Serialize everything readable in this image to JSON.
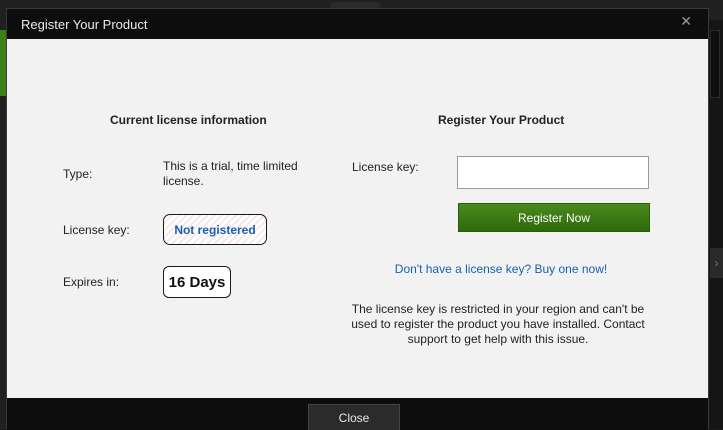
{
  "dialog": {
    "title": "Register Your Product",
    "close_icon": "close-icon"
  },
  "license_info": {
    "heading": "Current license information",
    "type_label": "Type:",
    "type_value": "This is a trial, time limited license.",
    "key_label": "License key:",
    "key_value": "Not registered",
    "expires_label": "Expires in:",
    "expires_value": "16 Days"
  },
  "register": {
    "heading": "Register Your Product",
    "key_label": "License key:",
    "key_input_value": "",
    "button_label": "Register Now",
    "buy_link": "Don't have a license key? Buy one now!",
    "notice": "The license key is restricted in your region and can't be used to register the product you have installed. Contact support to get help with this issue."
  },
  "footer": {
    "close_label": "Close"
  },
  "colors": {
    "accent_green": "#3f7f16",
    "link_blue": "#1a5fad",
    "titlebar": "#0d0d0d"
  }
}
